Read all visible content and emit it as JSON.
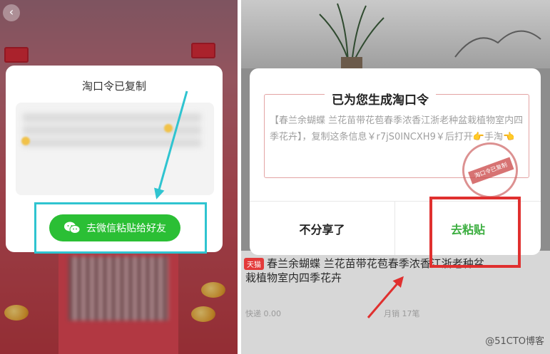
{
  "left_screen": {
    "back_glyph": "‹",
    "dialog_title": "淘口令已复制",
    "share_button_label": "去微信粘贴给好友",
    "share_button_icon": "wechat-icon",
    "annotation_color": "#2fc4d0"
  },
  "right_screen": {
    "dialog_title": "已为您生成淘口令",
    "token_text": "【春兰余蝴蝶 兰花苗带花苞春季浓香江浙老种盆栽植物室内四季花卉】，复制这条信息￥r7jS0INCXH9￥后打开👉手淘👈",
    "stamp_label": "淘口令已复制",
    "no_share_label": "不分享了",
    "paste_label": "去粘贴",
    "product_badge": "天猫",
    "product_title": "春兰余蝴蝶 兰花苗带花苞春季浓香江浙老种盆栽植物室内四季花卉",
    "product_meta_left": "快递 0.00",
    "product_meta_right": "月销 17笔",
    "annotation_color": "#e0302f"
  },
  "watermark": "@51CTO博客"
}
